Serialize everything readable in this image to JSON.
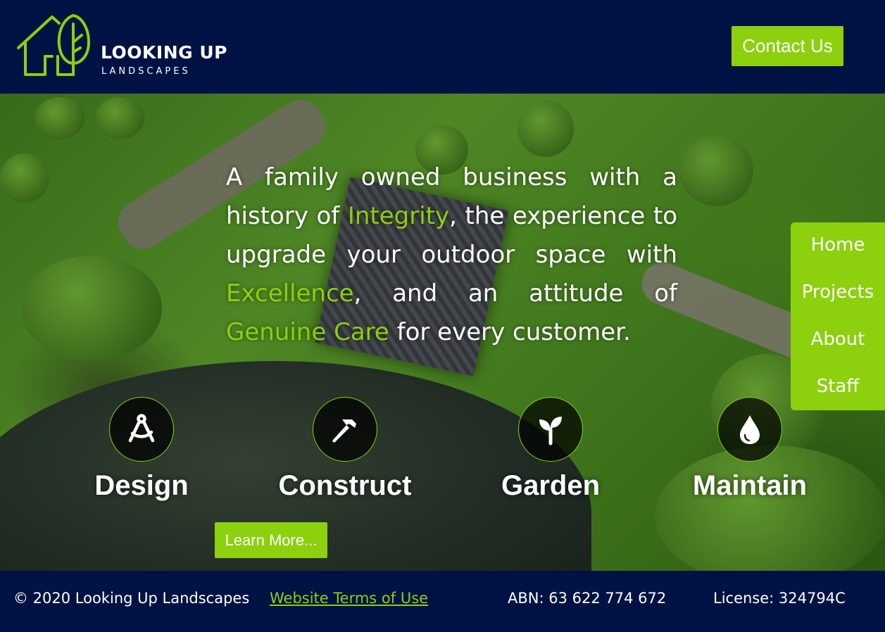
{
  "header": {
    "logo_name": "LOOKING UP",
    "logo_sub": "LANDSCAPES",
    "contact_label": "Contact Us"
  },
  "hero": {
    "tagline": {
      "p1": "A family owned business with a history of ",
      "h1": "Integrity",
      "p2": ", the experience to upgrade your outdoor space with ",
      "h2": "Excellence",
      "p3": ", and an attitude of ",
      "h3": "Genuine Care",
      "p4": " for every customer."
    },
    "services": [
      {
        "label": "Design",
        "icon": "drafting-compass-icon"
      },
      {
        "label": "Construct",
        "icon": "hammer-icon"
      },
      {
        "label": "Garden",
        "icon": "seedling-icon"
      },
      {
        "label": "Maintain",
        "icon": "water-drop-icon"
      }
    ],
    "learn_more_label": "Learn More..."
  },
  "nav": {
    "items": [
      {
        "label": "Home"
      },
      {
        "label": "Projects"
      },
      {
        "label": "About"
      },
      {
        "label": "Staff"
      }
    ]
  },
  "footer": {
    "copyright": "© 2020 Looking Up Landscapes",
    "terms_link": "Website Terms of Use",
    "abn": "ABN: 63 622 774 672",
    "license": "License: 324794C"
  },
  "colors": {
    "navy": "#001244",
    "accent": "#8cd00e",
    "text": "#ffffff"
  }
}
